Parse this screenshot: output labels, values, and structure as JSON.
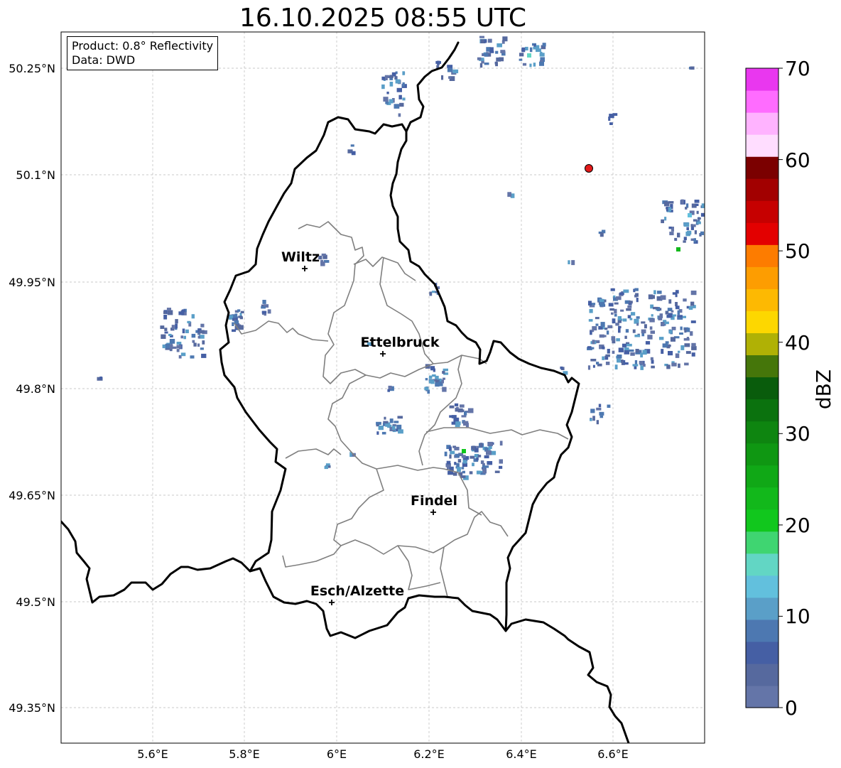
{
  "title": "16.10.2025 08:55 UTC",
  "info": {
    "product": "Product: 0.8° Reflectivity",
    "source": "Data: DWD"
  },
  "lon_labels": [
    "5.6°E",
    "5.8°E",
    "6°E",
    "6.2°E",
    "6.4°E",
    "6.6°E"
  ],
  "lat_labels": [
    "50.25°N",
    "50.1°N",
    "49.95°N",
    "49.8°N",
    "49.65°N",
    "49.5°N",
    "49.35°N"
  ],
  "cities": [
    {
      "name": "Wiltz"
    },
    {
      "name": "Ettelbruck"
    },
    {
      "name": "Findel"
    },
    {
      "name": "Esch/Alzette"
    }
  ],
  "colorbar": {
    "label": "dBZ",
    "ticks": [
      "0",
      "10",
      "20",
      "30",
      "40",
      "50",
      "60",
      "70"
    ],
    "colors": [
      "#6475a8",
      "#56699e",
      "#455fa4",
      "#4d78b1",
      "#5a9fc8",
      "#62c0dd",
      "#62d6c4",
      "#3fd571",
      "#11c71d",
      "#12b81b",
      "#10a816",
      "#0f9712",
      "#0e8510",
      "#0b720e",
      "#095c0c",
      "#45760a",
      "#b0b105",
      "#fdd700",
      "#fdb902",
      "#fd9d01",
      "#fd7c00",
      "#e30000",
      "#c60000",
      "#a20000",
      "#7b0000",
      "#ffddff",
      "#ffb3ff",
      "#ff6cff",
      "#e937ef"
    ]
  },
  "colors": {
    "border": "#000000",
    "cantons": "#7f7f7f",
    "grid": "#b8b8b8",
    "radar_site": "#e31a1a"
  }
}
